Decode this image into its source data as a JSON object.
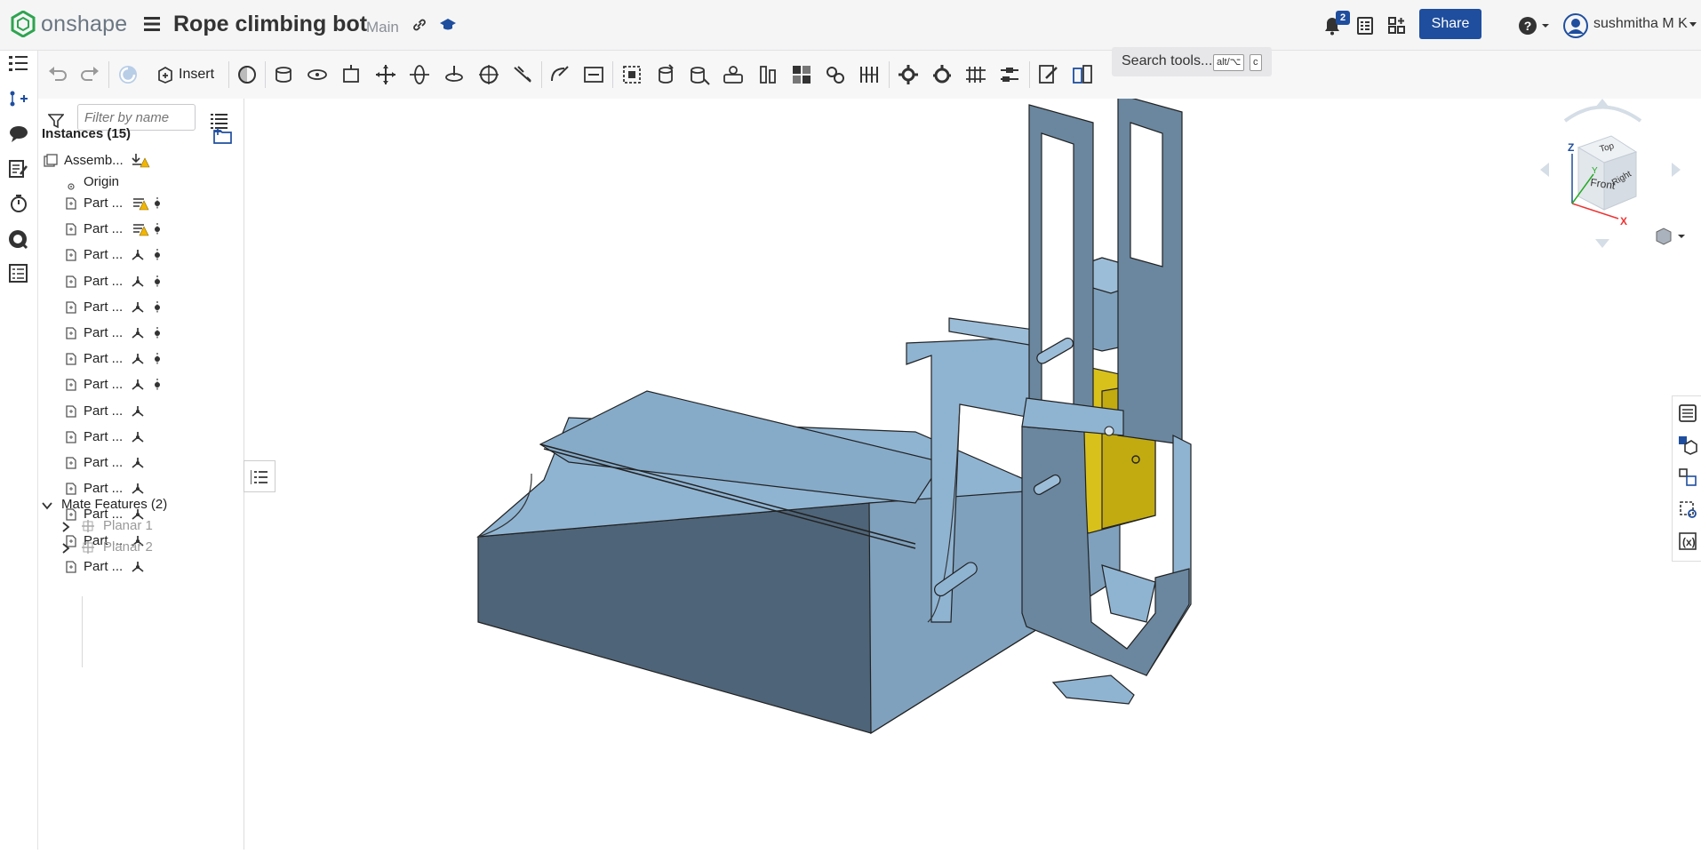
{
  "app": {
    "logo_text": "onshape"
  },
  "document": {
    "title": "Rope climbing bot",
    "branch": "Main"
  },
  "header": {
    "notification_count": "2",
    "share_label": "Share",
    "user_name": "sushmitha M K",
    "icons": [
      "link-icon",
      "education-icon",
      "bell-icon",
      "tasks-icon",
      "app-store-icon",
      "learning-center-icon",
      "help-icon",
      "user-avatar"
    ]
  },
  "toolbar": {
    "insert_label": "Insert",
    "search_label": "Search tools...",
    "search_kbd_1": "alt/⌥",
    "search_kbd_2": "c"
  },
  "panel": {
    "filter_placeholder": "Filter by name",
    "instances_header": "Instances (15)",
    "assembly_label": "Assemb...",
    "origin_label": "Origin",
    "part_label": "Part ...",
    "mate_header": "Mate Features (2)",
    "mates": [
      "Planar 1",
      "Planar 2"
    ]
  },
  "viewcube": {
    "front": "Front",
    "top": "Top",
    "right": "Right",
    "axis_x": "X",
    "axis_y": "Y",
    "axis_z": "Z"
  },
  "colors": {
    "accent": "#1f4e9e",
    "part_blue": "#8fb4d2",
    "part_shadow": "#4a6074",
    "yellow": "#d8c11a",
    "warning": "#f2b600"
  }
}
